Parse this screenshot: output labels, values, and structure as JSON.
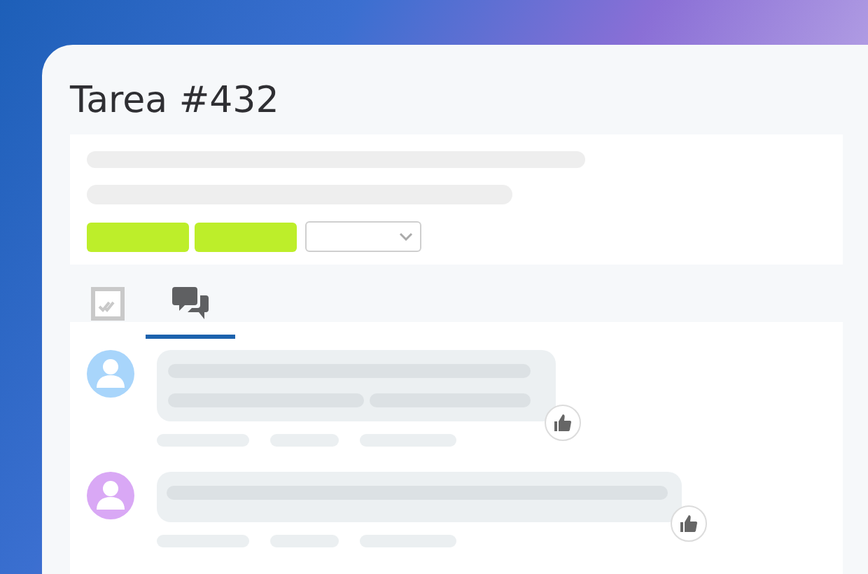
{
  "title": "Tarea #432",
  "tabs": [
    {
      "kind": "checklist",
      "selected": false
    },
    {
      "kind": "chat",
      "selected": true
    }
  ],
  "comments": [
    {
      "color": "#a8d5fb",
      "kind": "two-line"
    },
    {
      "color": "#d9a8f5",
      "kind": "one-line"
    }
  ]
}
